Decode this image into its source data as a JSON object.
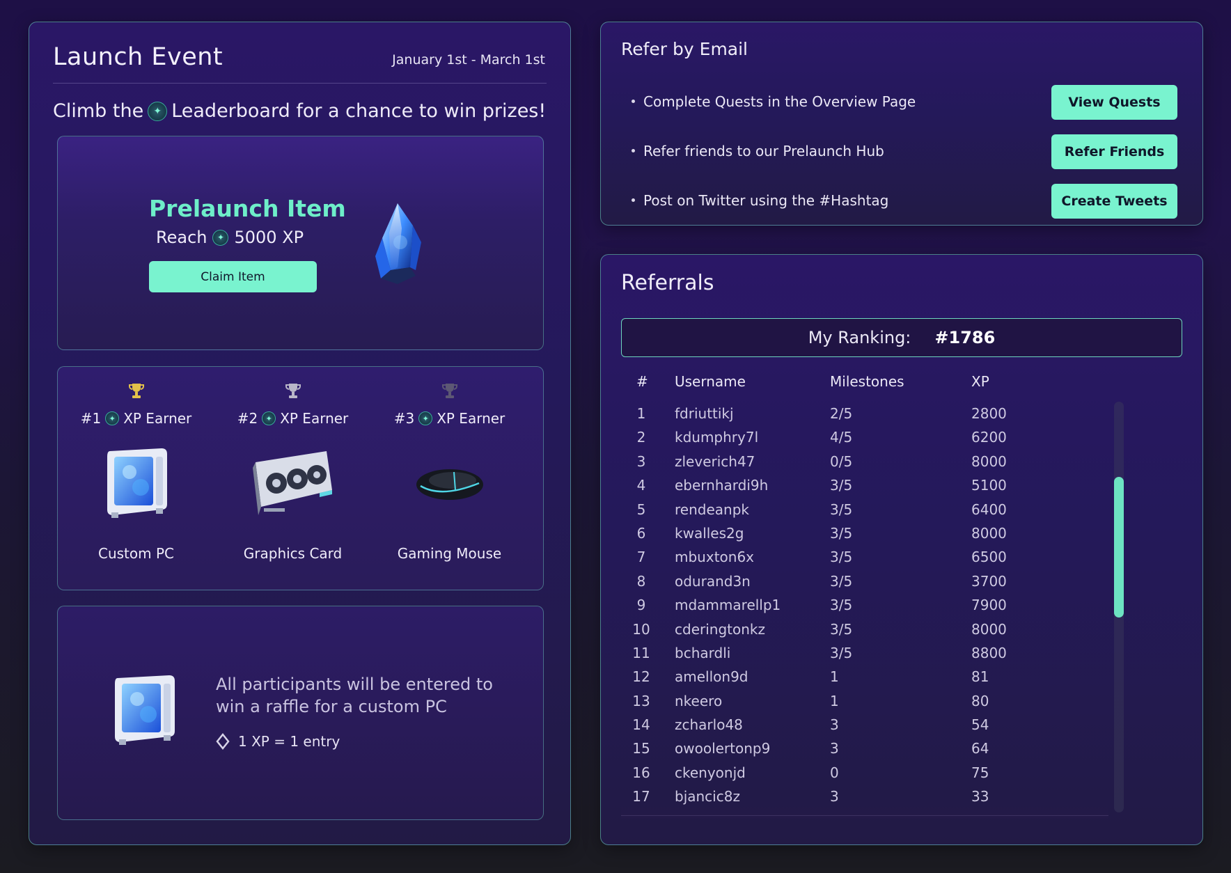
{
  "launch_event": {
    "title": "Launch Event",
    "dates": "January 1st - March 1st",
    "subtitle_pre": "Climb the",
    "subtitle_post": "Leaderboard for a chance to win prizes!",
    "prelaunch": {
      "title": "Prelaunch Item",
      "reach_label": "Reach",
      "reach_value": "5000 XP",
      "claim_label": "Claim Item"
    },
    "prizes": [
      {
        "rank": "#1",
        "label": "XP Earner",
        "name": "Custom PC",
        "trophy_color": "#e3c14a"
      },
      {
        "rank": "#2",
        "label": "XP Earner",
        "name": "Graphics Card",
        "trophy_color": "#b9b6c8"
      },
      {
        "rank": "#3",
        "label": "XP Earner",
        "name": "Gaming Mouse",
        "trophy_color": "#5d5874"
      }
    ],
    "raffle": {
      "text": "All participants will be entered to win a raffle for a custom PC",
      "entry": "1 XP = 1 entry"
    }
  },
  "refer_email": {
    "title": "Refer by Email",
    "quests": [
      {
        "text": "Complete Quests in the Overview Page",
        "button": "View Quests"
      },
      {
        "text": "Refer friends to our Prelaunch Hub",
        "button": "Refer Friends"
      },
      {
        "text": "Post on Twitter using the #Hashtag",
        "button": "Create Tweets"
      }
    ]
  },
  "referrals": {
    "title": "Referrals",
    "ranking_label": "My Ranking:",
    "ranking_value": "#1786",
    "columns": [
      "#",
      "Username",
      "Milestones",
      "XP"
    ],
    "rows": [
      [
        "1",
        "fdriuttikj",
        "2/5",
        "2800"
      ],
      [
        "2",
        "kdumphry7l",
        "4/5",
        "6200"
      ],
      [
        "3",
        "zleverich47",
        "0/5",
        "8000"
      ],
      [
        "4",
        "ebernhardi9h",
        "3/5",
        "5100"
      ],
      [
        "5",
        "rendeanpk",
        "3/5",
        "6400"
      ],
      [
        "6",
        "kwalles2g",
        "3/5",
        "8000"
      ],
      [
        "7",
        "mbuxton6x",
        "3/5",
        "6500"
      ],
      [
        "8",
        "odurand3n",
        "3/5",
        "3700"
      ],
      [
        "9",
        "mdammarellp1",
        "3/5",
        "7900"
      ],
      [
        "10",
        "cderingtonkz",
        "3/5",
        "8000"
      ],
      [
        "11",
        "bchardli",
        "3/5",
        "8800"
      ],
      [
        "12",
        "amellon9d",
        "1",
        "81"
      ],
      [
        "13",
        "nkeero",
        "1",
        "80"
      ],
      [
        "14",
        "zcharlo48",
        "3",
        "54"
      ],
      [
        "15",
        "owoolertonp9",
        "3",
        "64"
      ],
      [
        "16",
        "ckenyonjd",
        "0",
        "75"
      ],
      [
        "17",
        "bjancic8z",
        "3",
        "33"
      ]
    ]
  },
  "colors": {
    "accent": "#79f3cf",
    "accent_text": "#6eeec9",
    "panel_border": "#6ed6be"
  }
}
